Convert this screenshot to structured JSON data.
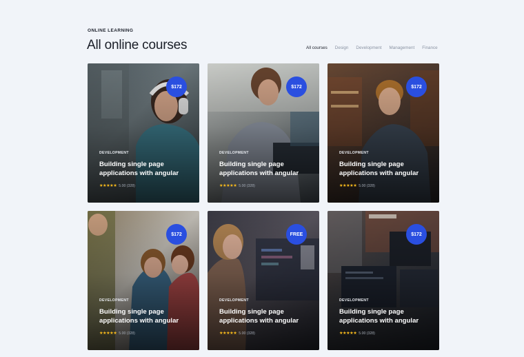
{
  "header": {
    "eyebrow": "ONLINE LEARNING",
    "title": "All online courses"
  },
  "tabs": [
    {
      "label": "All courses",
      "active": true
    },
    {
      "label": "Design",
      "active": false
    },
    {
      "label": "Development",
      "active": false
    },
    {
      "label": "Management",
      "active": false
    },
    {
      "label": "Finance",
      "active": false
    }
  ],
  "colors": {
    "accent": "#2a4fe0",
    "star": "#f5b81c",
    "background": "#f1f4f9"
  },
  "courses": [
    {
      "price": "$172",
      "category": "DEVELOPMENT",
      "title": "Building single page applications with angular",
      "stars": "★★★★★",
      "rating_text": "5.00 (328)"
    },
    {
      "price": "$172",
      "category": "DEVELOPMENT",
      "title": "Building single page applications with angular",
      "stars": "★★★★★",
      "rating_text": "5.00 (328)"
    },
    {
      "price": "$172",
      "category": "DEVELOPMENT",
      "title": "Building single page applications with angular",
      "stars": "★★★★★",
      "rating_text": "5.00 (328)"
    },
    {
      "price": "$172",
      "category": "DEVELOPMENT",
      "title": "Building single page applications with angular",
      "stars": "★★★★★",
      "rating_text": "5.00 (328)"
    },
    {
      "price": "FREE",
      "category": "DEVELOPMENT",
      "title": "Building single page applications with angular",
      "stars": "★★★★★",
      "rating_text": "5.00 (328)"
    },
    {
      "price": "$172",
      "category": "DEVELOPMENT",
      "title": "Building single page applications with angular",
      "stars": "★★★★★",
      "rating_text": "5.00 (328)"
    }
  ]
}
